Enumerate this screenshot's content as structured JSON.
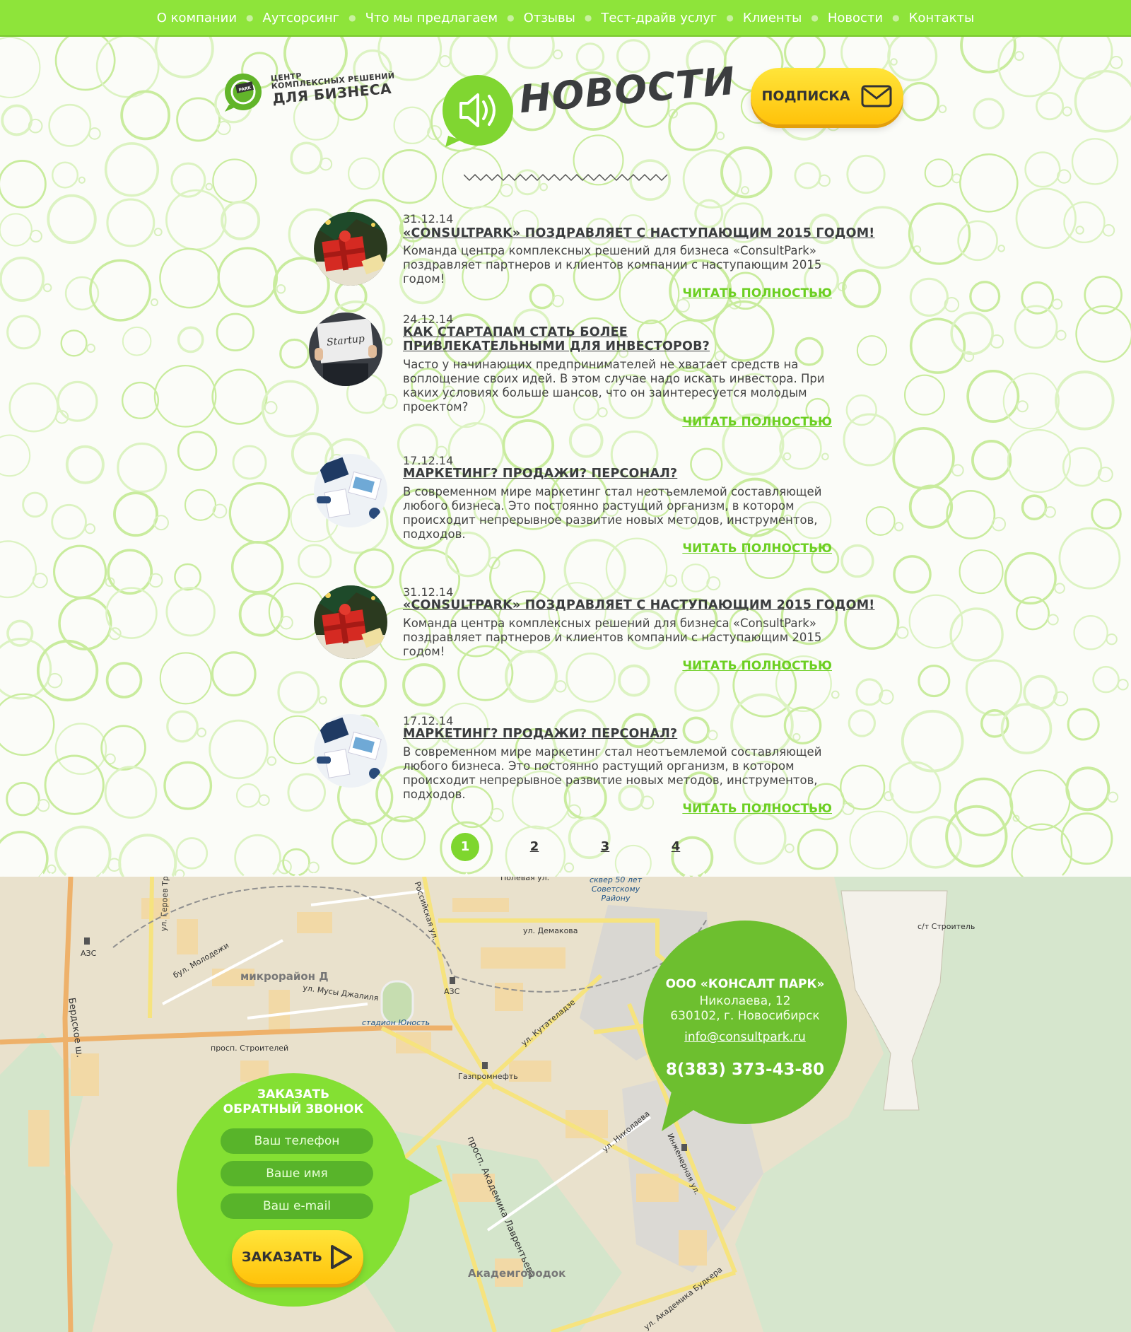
{
  "nav": {
    "items": [
      "О компании",
      "Аутсорсинг",
      "Что мы предлагаем",
      "Отзывы",
      "Тест-драйв услуг",
      "Клиенты",
      "Новости",
      "Контакты"
    ]
  },
  "header": {
    "logo": {
      "badge": "CONSULT PARK",
      "line1": "ЦЕНТР",
      "line2": "КОМПЛЕКСНЫХ РЕШЕНИЙ",
      "line3": "ДЛЯ БИЗНЕСА"
    },
    "page_title": "НОВОСТИ",
    "subscribe_label": "ПОДПИСКА"
  },
  "news": [
    {
      "date": "31.12.14",
      "title": "«CONSULTPARK» ПОЗДРАВЛЯЕТ С НАСТУПАЮЩИМ 2015 ГОДОМ!",
      "text": "Команда центра комплексных решений для бизнеса «ConsultPark» поздравляет партнеров и клиентов компании с наступающим 2015 годом!",
      "read_more": "ЧИТАТЬ ПОЛНОСТЬЮ",
      "image": "gift-icon"
    },
    {
      "date": "24.12.14",
      "title": "КАК СТАРТАПАМ СТАТЬ БОЛЕЕ ПРИВЛЕКАТЕЛЬНЫМИ ДЛЯ ИНВЕСТОРОВ?",
      "text": "Часто у начинающих предпринимателей не хватает средств на воплощение своих идей. В этом случае надо искать инвестора. При каких условиях больше шансов, что он заинтересуется молодым проектом?",
      "read_more": "ЧИТАТЬ ПОЛНОСТЬЮ",
      "image": "startup-sign",
      "image_text": "Startup"
    },
    {
      "date": "17.12.14",
      "title": "МАРКЕТИНГ? ПРОДАЖИ? ПЕРСОНАЛ?",
      "text": "В современном мире маркетинг стал неотъемлемой составляющей любого бизнеса. Это постоянно растущий организм, в котором происходит непрерывное развитие новых методов, инструментов, подходов.",
      "read_more": "ЧИТАТЬ ПОЛНОСТЬЮ",
      "image": "office-desk-icon"
    },
    {
      "date": "31.12.14",
      "title": "«CONSULTPARK» ПОЗДРАВЛЯЕТ С НАСТУПАЮЩИМ 2015 ГОДОМ!",
      "text": "Команда центра комплексных решений для бизнеса «ConsultPark» поздравляет партнеров и клиентов компании с наступающим 2015 годом!",
      "read_more": "ЧИТАТЬ ПОЛНОСТЬЮ",
      "image": "gift-icon"
    },
    {
      "date": "17.12.14",
      "title": "МАРКЕТИНГ? ПРОДАЖИ? ПЕРСОНАЛ?",
      "text": "В современном мире маркетинг стал неотъемлемой составляющей любого бизнеса. Это постоянно растущий организм, в котором происходит непрерывное развитие новых методов, инструментов, подходов.",
      "read_more": "ЧИТАТЬ ПОЛНОСТЬЮ",
      "image": "office-desk-icon"
    }
  ],
  "pagination": {
    "pages": [
      "1",
      "2",
      "3",
      "4"
    ],
    "active": "1"
  },
  "map": {
    "labels": {
      "polevaya": "Полевая ул.",
      "skver": "сквер 50 лет Советскому Району",
      "st_stroitel": "с/т Строитель",
      "geroev_truda": "ул. Героев Тр.",
      "rossiyskaya": "Российская ул.",
      "demakova": "ул. Демакова",
      "azs1": "АЗС",
      "azs2": "АЗС",
      "molodezhi": "бул. Молодежи",
      "mikrorayon": "микрорайон Д",
      "musy_dzhalilya": "ул. Мусы Джалиля",
      "stadion": "стадион Юность",
      "kutateladze": "ул. Кутателадзе",
      "berdskoe": "Бердское ш.",
      "stroiteley": "просп. Строителей",
      "gazpromneft": "Газпромнефть",
      "nikolaeva": "ул. Николаева",
      "inzhenernaya": "Инженерная ул.",
      "lavrentyeva": "просп. Академика Лаврентьева",
      "akademgorodok": "Академгородок",
      "budkera": "ул. Академика Будкера"
    }
  },
  "contact": {
    "company": "ООО «КОНСАЛТ ПАРК»",
    "address_line1": "Николаева, 12",
    "address_line2": "630102, г. Новосибирск",
    "email": "info@consultpark.ru",
    "phone": "8(383) 373-43-80"
  },
  "callback": {
    "title_line1": "ЗАКАЗАТЬ",
    "title_line2": "ОБРАТНЫЙ ЗВОНОК",
    "phone_placeholder": "Ваш телефон",
    "name_placeholder": "Ваше имя",
    "email_placeholder": "Ваш e-mail",
    "order_label": "ЗАКАЗАТЬ"
  },
  "colors": {
    "brand_green": "#8ee43a",
    "dark_green": "#6dbf2f",
    "link_green": "#6ccf22",
    "button_yellow": "#ffd21e",
    "text_dark": "#3a3c3e"
  }
}
